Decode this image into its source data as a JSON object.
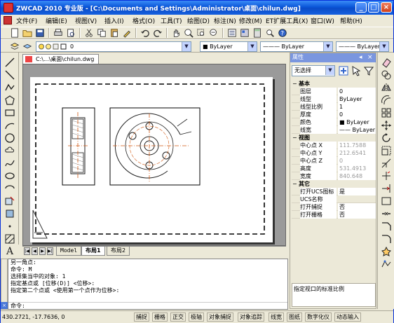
{
  "window": {
    "title": "ZWCAD 2010 专业版 - [C:\\Documents and Settings\\Administrator\\桌面\\chilun.dwg]",
    "min_label": "_",
    "max_label": "□",
    "close_label": "×"
  },
  "menu": {
    "items": [
      "文件(F)",
      "编辑(E)",
      "视图(V)",
      "插入(I)",
      "格式(O)",
      "工具(T)",
      "绘图(D)",
      "标注(N)",
      "修改(M)",
      "ET扩展工具(X)",
      "窗口(W)",
      "帮助(H)"
    ]
  },
  "layer_bar": {
    "layer_value": "0",
    "color_value": "■ ByLayer",
    "linetype_value": "——— ByLayer",
    "lineweight_value": "——— ByLayer"
  },
  "document": {
    "tab_label": "C:\\...\\桌面\\chilun.dwg",
    "layout_tabs": [
      "Model",
      "布局1",
      "布局2"
    ],
    "active_layout": "布局1",
    "nav": [
      "|◀",
      "◀",
      "▶",
      "▶|"
    ]
  },
  "properties": {
    "title": "属性",
    "selection": "无选择",
    "categories": [
      {
        "name": "基本",
        "rows": [
          {
            "k": "图层",
            "v": "0"
          },
          {
            "k": "线型",
            "v": "ByLayer"
          },
          {
            "k": "线型比例",
            "v": "1"
          },
          {
            "k": "厚度",
            "v": "0"
          },
          {
            "k": "颜色",
            "v": "■ ByLayer"
          },
          {
            "k": "线宽",
            "v": "—— ByLayer"
          }
        ]
      },
      {
        "name": "视图",
        "rows": [
          {
            "k": "中心点 X",
            "v": "111.7588",
            "ro": true
          },
          {
            "k": "中心点 Y",
            "v": "212.6541",
            "ro": true
          },
          {
            "k": "中心点 Z",
            "v": "0",
            "ro": true
          },
          {
            "k": "高度",
            "v": "531.4913",
            "ro": true
          },
          {
            "k": "宽度",
            "v": "840.648",
            "ro": true
          }
        ]
      },
      {
        "name": "其它",
        "rows": [
          {
            "k": "打开UCS图标",
            "v": "是"
          },
          {
            "k": "UCS名称",
            "v": ""
          },
          {
            "k": "打开捕捉",
            "v": "否"
          },
          {
            "k": "打开栅格",
            "v": "否"
          }
        ]
      }
    ],
    "description": "指定视口的标准比例"
  },
  "command": {
    "lines": [
      "另一角点:",
      "命令: M",
      "选择集当中的对象: 1",
      "指定基点或 [位移(D)] <位移>:",
      "指定第二个点或 <使用第一个点作为位移>:"
    ],
    "prompt": "命令:"
  },
  "status": {
    "coords": "430.2721, -17.7636, 0",
    "buttons": [
      {
        "label": "捕捉",
        "on": false
      },
      {
        "label": "栅格",
        "on": false
      },
      {
        "label": "正交",
        "on": false
      },
      {
        "label": "极轴",
        "on": false
      },
      {
        "label": "对象捕捉",
        "on": false
      },
      {
        "label": "对象追踪",
        "on": false
      },
      {
        "label": "线宽",
        "on": false
      },
      {
        "label": "图纸",
        "on": false
      },
      {
        "label": "数字化仪",
        "on": false
      },
      {
        "label": "动态输入",
        "on": false
      }
    ]
  }
}
